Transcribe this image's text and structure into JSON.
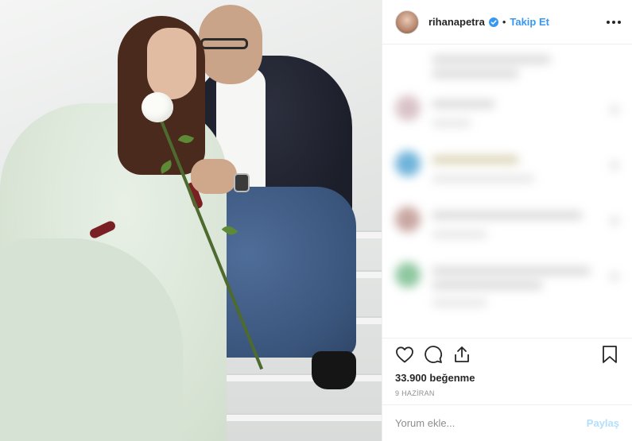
{
  "post": {
    "username": "rihanapetra",
    "follow_label": "Takip Et",
    "dot": "•",
    "likes": "33.900 beğenme",
    "date": "9 HAZİRAN",
    "comment_placeholder": "Yorum ekle...",
    "post_label": "Paylaş"
  },
  "icons": {
    "verified": "verified-badge-icon",
    "more": "more-options-icon",
    "like": "heart-icon",
    "comment": "comment-icon",
    "share": "share-icon",
    "save": "bookmark-icon"
  },
  "colors": {
    "accent": "#3897f0",
    "post_disabled": "#b2dffc",
    "text": "#262626",
    "muted": "#8e8e8e"
  }
}
